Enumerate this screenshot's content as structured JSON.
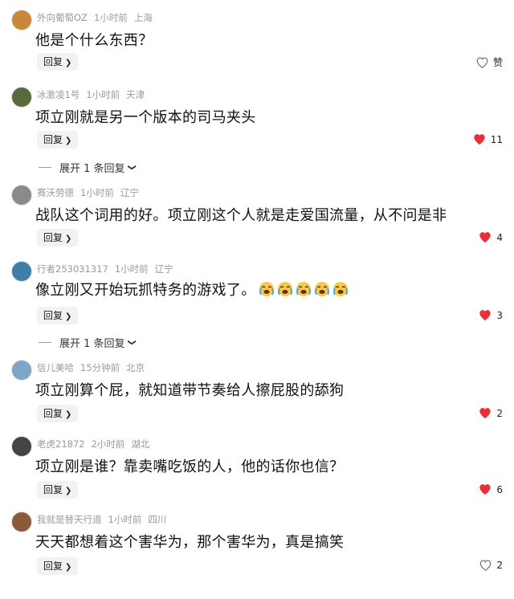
{
  "comments": [
    {
      "username": "外向葡萄OZ",
      "time": "1小时前",
      "location": "上海",
      "text": "他是个什么东西？",
      "reply_label": "回复",
      "likes": "赞",
      "liked": false,
      "avatar_color": "#c9873a"
    },
    {
      "username": "冰激凌1号",
      "time": "1小时前",
      "location": "天津",
      "text": "项立刚就是另一个版本的司马夹头",
      "reply_label": "回复",
      "likes": "11",
      "liked": true,
      "avatar_color": "#5a6a3a"
    },
    {
      "username": "赛沃劳德",
      "time": "1小时前",
      "location": "辽宁",
      "text": "战队这个词用的好。项立刚这个人就是走爱国流量，从不问是非",
      "reply_label": "回复",
      "likes": "4",
      "liked": true,
      "avatar_color": "#8a8a8a"
    },
    {
      "username": "行者253031317",
      "time": "1小时前",
      "location": "辽宁",
      "text": "像立刚又开始玩抓特务的游戏了。",
      "reply_label": "回复",
      "likes": "3",
      "liked": true,
      "avatar_color": "#3d7fa6",
      "emoji": "cry-laugh"
    },
    {
      "username": "信儿美哈",
      "time": "15分钟前",
      "location": "北京",
      "text": "项立刚算个屁，就知道带节奏给人擦屁股的舔狗",
      "reply_label": "回复",
      "likes": "2",
      "liked": true,
      "avatar_color": "#7fa6c9"
    },
    {
      "username": "老虎21872",
      "time": "2小时前",
      "location": "湖北",
      "text": "项立刚是谁？靠卖嘴吃饭的人，他的话你也信？",
      "reply_label": "回复",
      "likes": "6",
      "liked": true,
      "avatar_color": "#444444"
    },
    {
      "username": "我就是替天行道",
      "time": "1小时前",
      "location": "四川",
      "text": "天天都想着这个害华为，那个害华为，真是搞笑",
      "reply_label": "回复",
      "likes": "2",
      "liked": false,
      "avatar_color": "#8a5a3a"
    }
  ],
  "expand_replies": [
    "展开 1 条回复",
    "展开 1 条回复"
  ],
  "colors": {
    "like_red": "#e8303a",
    "meta_gray": "#9a9a9a",
    "reply_bg": "#f2f2f2"
  }
}
